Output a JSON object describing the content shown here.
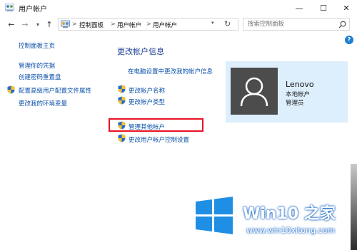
{
  "window": {
    "title": "用户帐户",
    "controls": {
      "minimize": "—",
      "maximize": "☐",
      "close": "✕"
    }
  },
  "nav": {
    "back": "←",
    "forward": "→",
    "recent": "▾",
    "up": "↑"
  },
  "address": {
    "crumbs": [
      "控制面板",
      "用户帐户",
      "用户帐户"
    ],
    "separator": ">",
    "dropdown": "▾",
    "refresh": "↻"
  },
  "search": {
    "placeholder": "搜索控制面板"
  },
  "help": {
    "label": "?"
  },
  "sidebar": {
    "home": "控制面板主页",
    "items": [
      {
        "label": "管理你的凭据",
        "shield": false
      },
      {
        "label": "创建密码重置盘",
        "shield": false
      },
      {
        "label": "配置高级用户配置文件属性",
        "shield": true
      },
      {
        "label": "更改我的环境变量",
        "shield": false
      }
    ]
  },
  "main": {
    "title": "更改帐户信息",
    "pc_settings_link": "在电脑设置中更改我的帐户信息",
    "links": [
      {
        "label": "更改帐户名称",
        "shield": true
      },
      {
        "label": "更改帐户类型",
        "shield": true
      },
      {
        "label": "管理其他帐户",
        "shield": true,
        "highlighted": true
      },
      {
        "label": "更改用户帐户控制设置",
        "shield": true
      }
    ]
  },
  "user": {
    "name": "Lenovo",
    "account_type": "本地帐户",
    "role": "管理员"
  },
  "watermark": {
    "brand": "Win10 之家",
    "url": "www.win10xitong.com"
  },
  "colors": {
    "link": "#0b50a8",
    "title_blue": "#1c3f94",
    "highlight_red": "#e81123",
    "card_bg": "#ddeefc",
    "avatar_bg": "#4c4c4c"
  }
}
